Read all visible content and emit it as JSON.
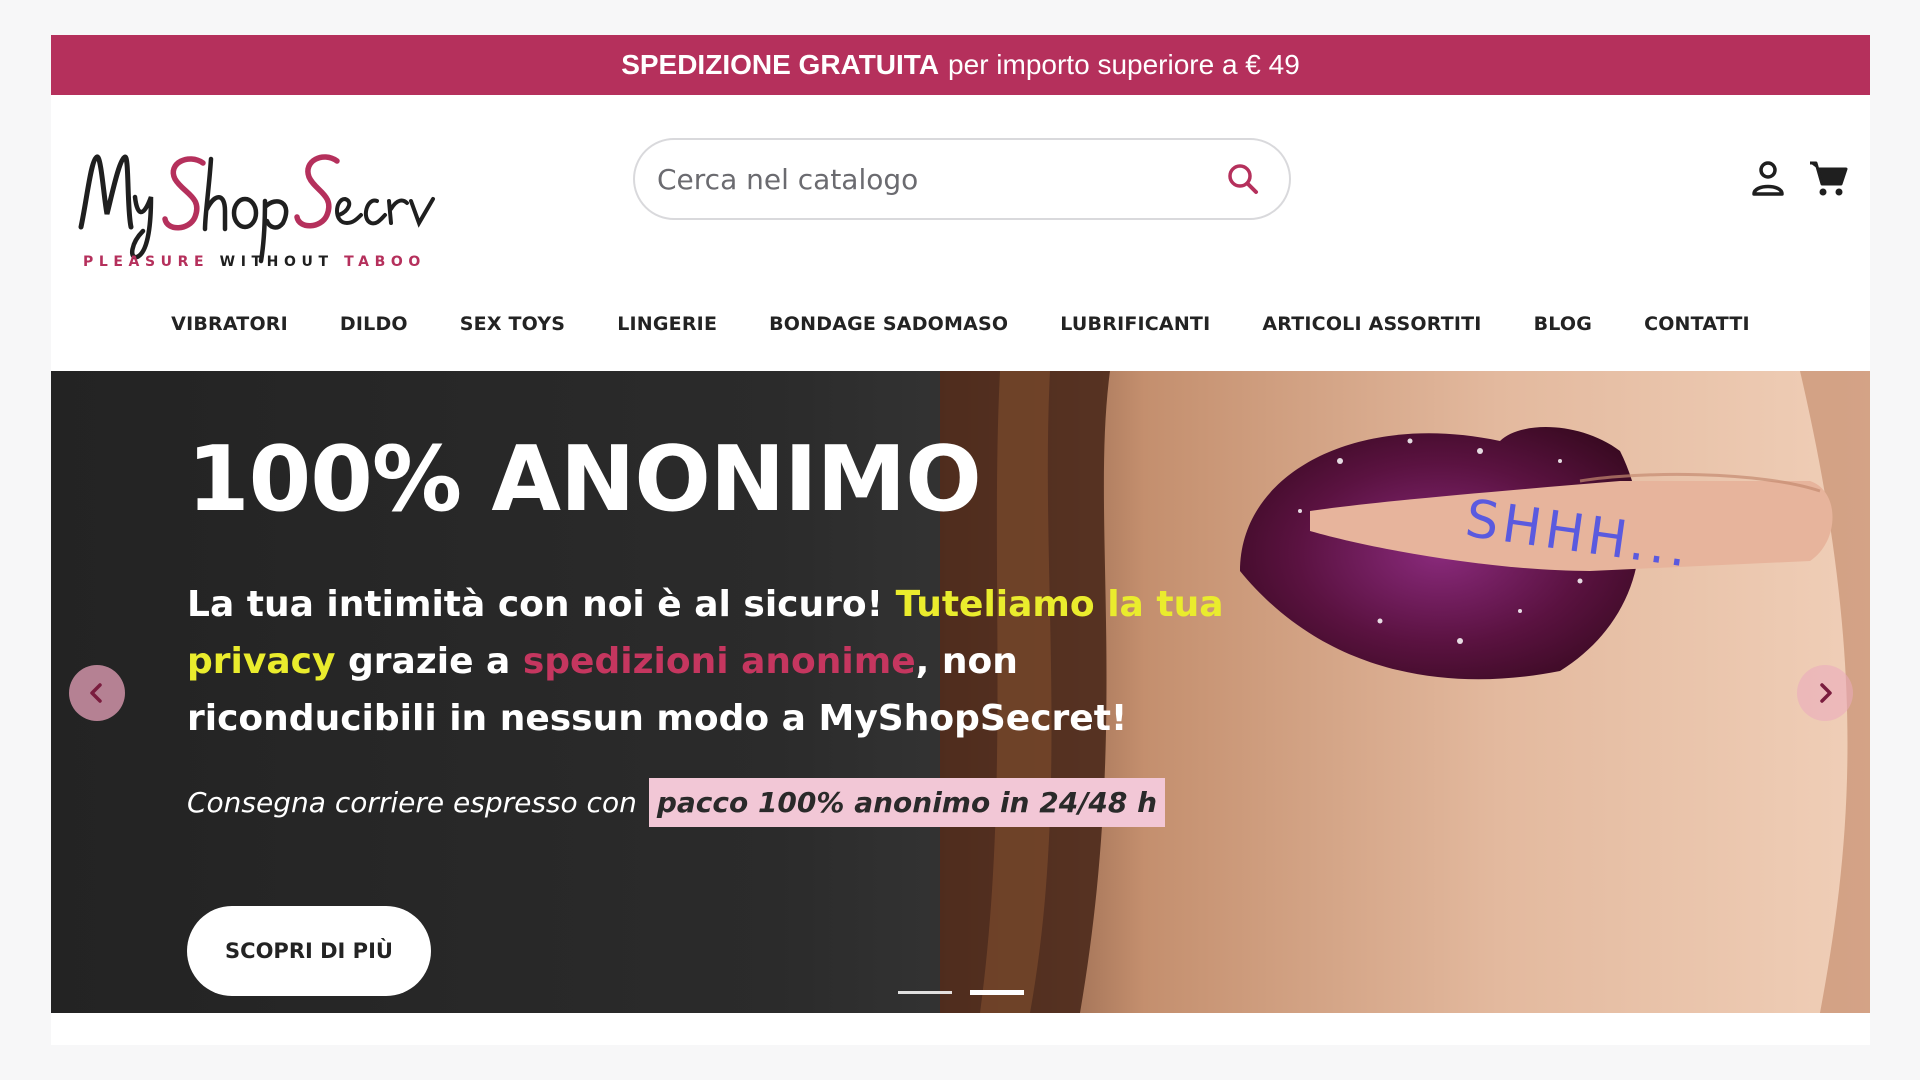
{
  "top_bar": {
    "bold_text": "SPEDIZIONE GRATUITA",
    "text": "per importo superiore a € 49",
    "background_color": "#b5305c"
  },
  "logo": {
    "wordmark": "MyShopSecret",
    "tagline": "PLEASURE WITHOUT TABOO"
  },
  "search": {
    "placeholder": "Cerca nel catalogo",
    "value": "",
    "icon": "search-icon"
  },
  "header_icons": [
    "user-icon",
    "cart-icon"
  ],
  "nav": {
    "items": [
      "VIBRATORI",
      "DILDO",
      "SEX TOYS",
      "LINGERIE",
      "BONDAGE SADOMASO",
      "LUBRIFICANTI",
      "ARTICOLI ASSORTITI",
      "BLOG",
      "CONTATTI"
    ]
  },
  "hero": {
    "title": "100% ANONIMO",
    "lead_1": "La tua intimità con noi è al sicuro! ",
    "lead_highlight_yellow": "Tuteliamo la tua privacy",
    "lead_2": " grazie a ",
    "lead_highlight_pink": "spedizioni anonime",
    "lead_3": ", non riconducibili in nessun modo a MyShopSecret!",
    "sub_text": "Consegna corriere espresso con",
    "sub_highlight": "pacco 100% anonimo in 24/48 h",
    "cta_label": "SCOPRI DI PIÙ",
    "photo_finger_text": "SHHH...",
    "slide_count": 2,
    "active_slide": 2,
    "colors": {
      "yellow_highlight": "#eaec2d",
      "pink_highlight": "#c5365f",
      "sub_highlight_bg": "#f2c7d6"
    }
  },
  "carousel_icons": [
    "chevron-left-icon",
    "chevron-right-icon"
  ]
}
